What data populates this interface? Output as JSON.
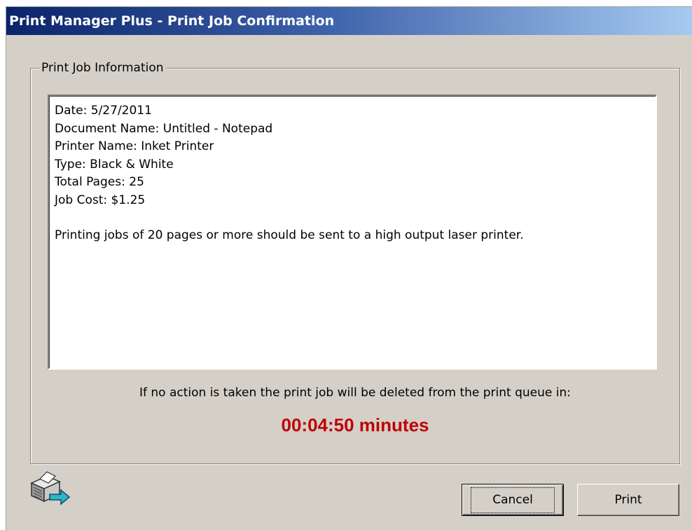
{
  "window": {
    "title": "Print Manager Plus - Print Job Confirmation"
  },
  "group": {
    "legend": "Print Job Information",
    "info_lines": [
      "Date: 5/27/2011",
      "Document Name: Untitled - Notepad",
      "Printer Name: Inket Printer",
      "Type: Black & White",
      "Total Pages: 25",
      "Job Cost: $1.25"
    ],
    "policy_message": "Printing jobs of 20 pages or more should be sent to a high output laser printer.",
    "warning_text": "If no action is taken the print job will be deleted from the print queue in:",
    "countdown": "00:04:50 minutes",
    "countdown_color": "#c00000"
  },
  "icons": {
    "app": "printer-arrow-icon"
  },
  "buttons": {
    "cancel_label": "Cancel",
    "print_label": "Print"
  }
}
